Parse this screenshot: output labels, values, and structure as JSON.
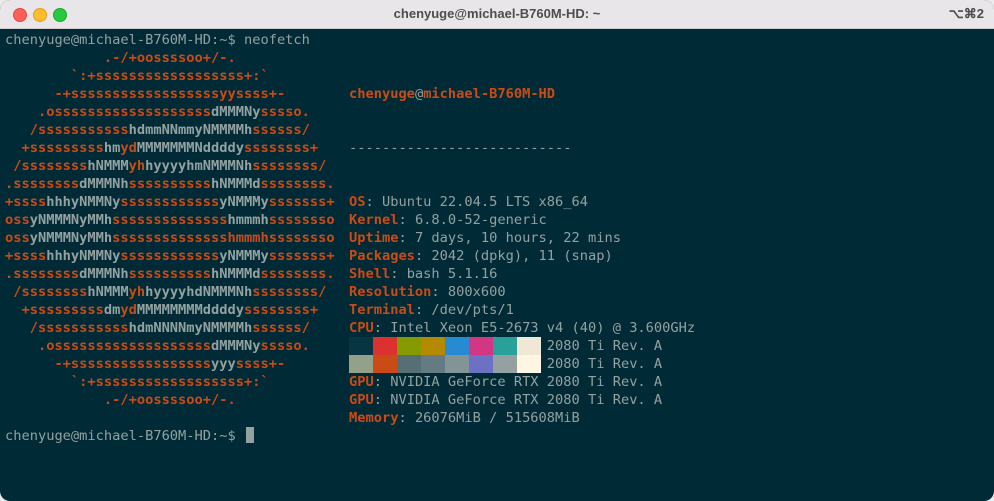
{
  "window": {
    "title": "chenyuge@michael-B760M-HD: ~",
    "shortcut": "⌥⌘2"
  },
  "terminal": {
    "prompt": "chenyuge@michael-B760M-HD:~$ ",
    "command": "neofetch",
    "final_prompt": "chenyuge@michael-B760M-HD:~$ "
  },
  "logo_lines": [
    [
      [
        "o",
        "            .-/+oossssoo+/-.               "
      ]
    ],
    [
      [
        "o",
        "        `:+ssssssssssssssssss+:`           "
      ]
    ],
    [
      [
        "o",
        "      -+ssssssssssssssssssyyssss+-         "
      ]
    ],
    [
      [
        "o",
        "    .osssssssssssssssssss"
      ],
      [
        "w",
        "dMMMNy"
      ],
      [
        "o",
        "sssso.       "
      ]
    ],
    [
      [
        "o",
        "   /sssssssssss"
      ],
      [
        "w",
        "hdmmNNmmyNMMMMh"
      ],
      [
        "o",
        "ssssss/      "
      ]
    ],
    [
      [
        "o",
        "  +sssssssss"
      ],
      [
        "w",
        "hm"
      ],
      [
        "o",
        "yd"
      ],
      [
        "w",
        "MMMMMMMNddddy"
      ],
      [
        "o",
        "ssssssss+     "
      ]
    ],
    [
      [
        "o",
        " /ssssssss"
      ],
      [
        "w",
        "hNMMM"
      ],
      [
        "o",
        "yh"
      ],
      [
        "w",
        "hyyyyhmNMMMNh"
      ],
      [
        "o",
        "ssssssss/    "
      ]
    ],
    [
      [
        "o",
        ".ssssssss"
      ],
      [
        "w",
        "dMMMNh"
      ],
      [
        "o",
        "ssssssssss"
      ],
      [
        "w",
        "hNMMMd"
      ],
      [
        "o",
        "ssssssss.   "
      ]
    ],
    [
      [
        "o",
        "+ssss"
      ],
      [
        "w",
        "hhhyNMMNy"
      ],
      [
        "o",
        "ssssssssssss"
      ],
      [
        "w",
        "yNMMMy"
      ],
      [
        "o",
        "sssssss+   "
      ]
    ],
    [
      [
        "o",
        "oss"
      ],
      [
        "w",
        "yNMMMNyMMh"
      ],
      [
        "o",
        "ssssssssssssss"
      ],
      [
        "w",
        "hmmmh"
      ],
      [
        "o",
        "ssssssso   "
      ]
    ],
    [
      [
        "o",
        "oss"
      ],
      [
        "w",
        "yNMMMNyMMh"
      ],
      [
        "o",
        "sssssssssssssshmmmhssssssso   "
      ]
    ],
    [
      [
        "o",
        "+ssss"
      ],
      [
        "w",
        "hhhyNMMNy"
      ],
      [
        "o",
        "ssssssssssss"
      ],
      [
        "w",
        "yNMMMy"
      ],
      [
        "o",
        "sssssss+   "
      ]
    ],
    [
      [
        "o",
        ".ssssssss"
      ],
      [
        "w",
        "dMMMNh"
      ],
      [
        "o",
        "ssssssssss"
      ],
      [
        "w",
        "hNMMMd"
      ],
      [
        "o",
        "ssssssss.   "
      ]
    ],
    [
      [
        "o",
        " /ssssssss"
      ],
      [
        "w",
        "hNMMM"
      ],
      [
        "o",
        "yh"
      ],
      [
        "w",
        "hyyyyhdNMMMNh"
      ],
      [
        "o",
        "ssssssss/    "
      ]
    ],
    [
      [
        "o",
        "  +sssssssss"
      ],
      [
        "w",
        "dm"
      ],
      [
        "o",
        "yd"
      ],
      [
        "w",
        "MMMMMMMMddddy"
      ],
      [
        "o",
        "ssssssss+     "
      ]
    ],
    [
      [
        "o",
        "   /sssssssssss"
      ],
      [
        "w",
        "hdmNNNNmyNMMMMh"
      ],
      [
        "o",
        "ssssss/      "
      ]
    ],
    [
      [
        "o",
        "    .osssssssssssssssssss"
      ],
      [
        "w",
        "dMMMNy"
      ],
      [
        "o",
        "sssso.       "
      ]
    ],
    [
      [
        "o",
        "      -+sssssssssssssssss"
      ],
      [
        "w",
        "yyy"
      ],
      [
        "o",
        "ssss+-         "
      ]
    ],
    [
      [
        "o",
        "        `:+ssssssssssssssssss+:`           "
      ]
    ],
    [
      [
        "o",
        "            .-/+oossssoo+/-.               "
      ]
    ]
  ],
  "info": {
    "user": "chenyuge",
    "at": "@",
    "host": "michael-B760M-HD",
    "separator": "---------------------------",
    "rows": [
      {
        "key": "OS",
        "value": "Ubuntu 22.04.5 LTS x86_64"
      },
      {
        "key": "Kernel",
        "value": "6.8.0-52-generic"
      },
      {
        "key": "Uptime",
        "value": "7 days, 10 hours, 22 mins"
      },
      {
        "key": "Packages",
        "value": "2042 (dpkg), 11 (snap)"
      },
      {
        "key": "Shell",
        "value": "bash 5.1.16"
      },
      {
        "key": "Resolution",
        "value": "800x600"
      },
      {
        "key": "Terminal",
        "value": "/dev/pts/1"
      },
      {
        "key": "CPU",
        "value": "Intel Xeon E5-2673 v4 (40) @ 3.600GHz"
      },
      {
        "key": "GPU",
        "value": "NVIDIA GeForce RTX 2080 Ti Rev. A"
      },
      {
        "key": "GPU",
        "value": "NVIDIA GeForce RTX 2080 Ti Rev. A"
      },
      {
        "key": "GPU",
        "value": "NVIDIA GeForce RTX 2080 Ti Rev. A"
      },
      {
        "key": "GPU",
        "value": "NVIDIA GeForce RTX 2080 Ti Rev. A"
      },
      {
        "key": "Memory",
        "value": "26076MiB / 515608MiB"
      }
    ]
  },
  "palette": {
    "normal": [
      "#073642",
      "#dc322f",
      "#859900",
      "#b58900",
      "#268bd2",
      "#d33682",
      "#2aa198",
      "#eee8d5"
    ],
    "bright": [
      "#93a18a",
      "#cb4b16",
      "#586e75",
      "#657b83",
      "#839496",
      "#6c71c4",
      "#93a1a1",
      "#fdf6e3"
    ]
  },
  "colors": {
    "background": "#002b36",
    "accent": "#cb4b16",
    "text": "#93a1a1"
  }
}
